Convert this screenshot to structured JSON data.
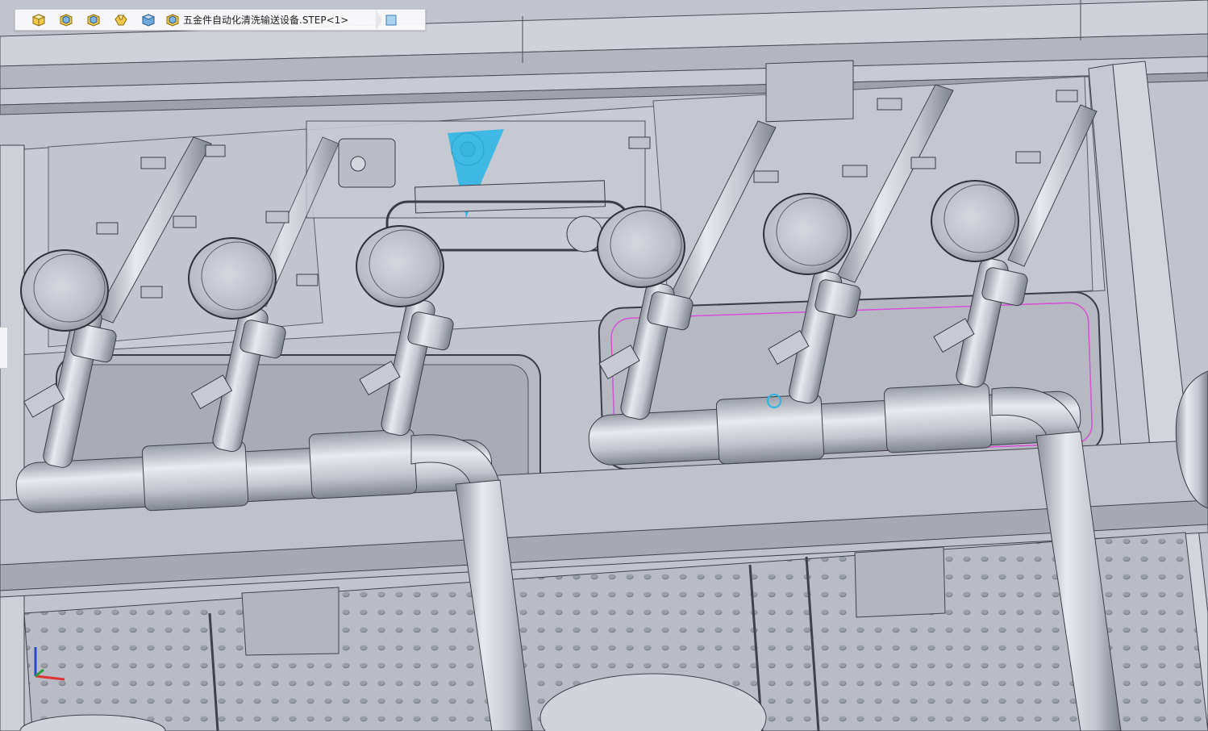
{
  "breadcrumb": {
    "items": [
      {
        "icon": "part-icon"
      },
      {
        "icon": "assembly-icon"
      },
      {
        "icon": "assembly-icon"
      },
      {
        "icon": "sub-assembly-icon"
      },
      {
        "icon": "body-icon"
      }
    ],
    "document_label": "五金件自动化清洗输送设备.STEP<1>",
    "document_icon": "assembly-icon",
    "last_icon": "face-icon"
  },
  "viewport": {
    "triad_axes": [
      "x-axis",
      "y-axis",
      "z-axis"
    ],
    "colors": {
      "selection_outline": "#d84fd8",
      "highlight_blue": "#27b6e6",
      "metal_body": "#c4c7d0",
      "edge_line": "#3a3d45"
    }
  }
}
